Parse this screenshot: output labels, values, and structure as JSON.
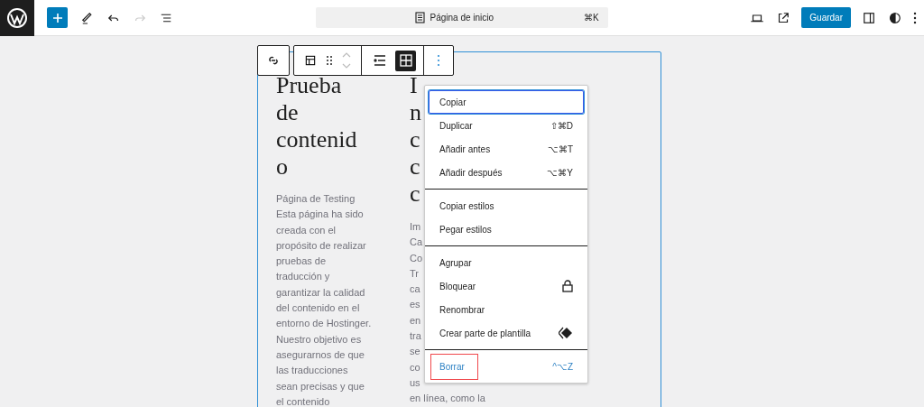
{
  "topbar": {
    "command_title": "Página de inicio",
    "command_shortcut": "⌘K",
    "save_label": "Guardar"
  },
  "block_toolbar": {
    "layout_options": [
      {
        "selected": false
      },
      {
        "selected": true
      }
    ]
  },
  "left_column": {
    "heading_lines": [
      "Prueba",
      "de",
      "contenid",
      "o"
    ],
    "body_lines": [
      "Página de Testing",
      "Esta página ha sido",
      "creada con el",
      "propósito de realizar",
      "pruebas de",
      "traducción y",
      "garantizar la calidad",
      "del contenido en el",
      "entorno de Hostinger.",
      "Nuestro objetivo es",
      "asegurarnos de que",
      "las traducciones",
      "sean precisas y que",
      "el contenido"
    ]
  },
  "right_column": {
    "heading_lines": [
      "I",
      "n",
      "c",
      "c",
      "c"
    ],
    "body_lines": [
      "Im",
      "Ca",
      "Co",
      "Tr",
      "ca",
      "es",
      "en",
      "tra",
      "se",
      "co",
      "us",
      "en línea, como la"
    ]
  },
  "menu": {
    "groups": [
      [
        {
          "label": "Copiar",
          "kind": "plain",
          "selected": true,
          "outlined": false,
          "accent": false
        },
        {
          "label": "Duplicar",
          "shortcut": "⇧⌘D",
          "kind": "plain",
          "selected": false,
          "outlined": false,
          "accent": false
        },
        {
          "label": "Añadir antes",
          "shortcut": "⌥⌘T",
          "kind": "plain",
          "selected": false,
          "outlined": false,
          "accent": false
        },
        {
          "label": "Añadir después",
          "shortcut": "⌥⌘Y",
          "kind": "plain",
          "selected": false,
          "outlined": false,
          "accent": false
        }
      ],
      [
        {
          "label": "Copiar estilos",
          "kind": "plain",
          "selected": false,
          "outlined": false,
          "accent": false
        },
        {
          "label": "Pegar estilos",
          "kind": "plain",
          "selected": false,
          "outlined": false,
          "accent": false
        }
      ],
      [
        {
          "label": "Agrupar",
          "kind": "plain",
          "selected": false,
          "outlined": false,
          "accent": false
        },
        {
          "label": "Bloquear",
          "kind": "lock",
          "selected": false,
          "outlined": false,
          "accent": false
        },
        {
          "label": "Renombrar",
          "kind": "plain",
          "selected": false,
          "outlined": false,
          "accent": false
        },
        {
          "label": "Crear parte de plantilla",
          "kind": "template",
          "selected": false,
          "outlined": false,
          "accent": false
        }
      ],
      [
        {
          "label": "Borrar",
          "shortcut": "^⌥Z",
          "kind": "plain",
          "selected": false,
          "outlined": true,
          "accent": true
        }
      ]
    ]
  }
}
